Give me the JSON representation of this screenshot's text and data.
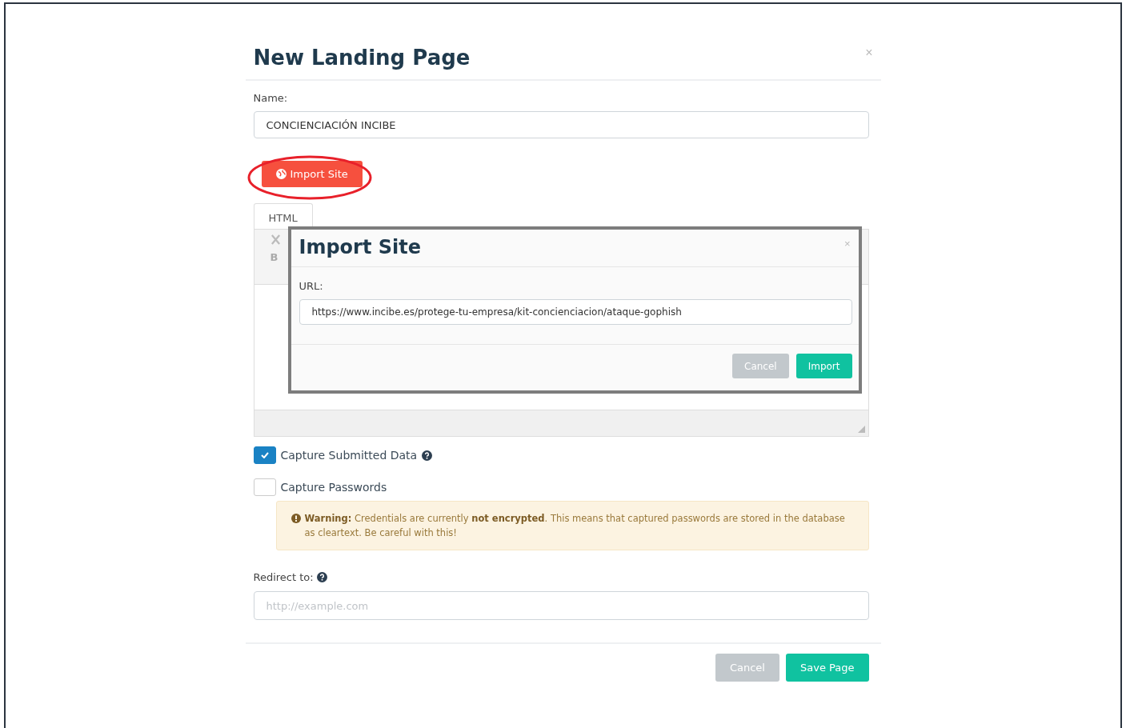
{
  "modal": {
    "title": "New Landing Page",
    "close": "×",
    "name_label": "Name:",
    "name_value": "CONCIENCIACIÓN INCIBE",
    "import_button": "Import Site",
    "editor": {
      "tabs": [
        {
          "label": "HTML",
          "selected": true
        }
      ],
      "bold": "B"
    },
    "checkboxes": [
      {
        "label": "Capture Submitted Data",
        "checked": true,
        "help": true
      },
      {
        "label": "Capture Passwords",
        "checked": false,
        "help": false
      }
    ],
    "warning": "**Warning:** Credentials are currently **not encrypted**. This means that captured passwords are stored in the database as cleartext. Be careful with this!",
    "redirect_label": "Redirect to:",
    "redirect_placeholder": "http://example.com",
    "buttons": [
      {
        "label": "Cancel",
        "kind": "secondary"
      },
      {
        "label": "Save Page",
        "kind": "primary"
      }
    ]
  },
  "dialog": {
    "title": "Import Site",
    "close": "×",
    "url_label": "URL:",
    "url_value": "https://www.incibe.es/protege-tu-empresa/kit-concienciacion/ataque-gophish",
    "buttons": [
      {
        "label": "Cancel",
        "kind": "secondary"
      },
      {
        "label": "Import",
        "kind": "primary"
      }
    ]
  }
}
